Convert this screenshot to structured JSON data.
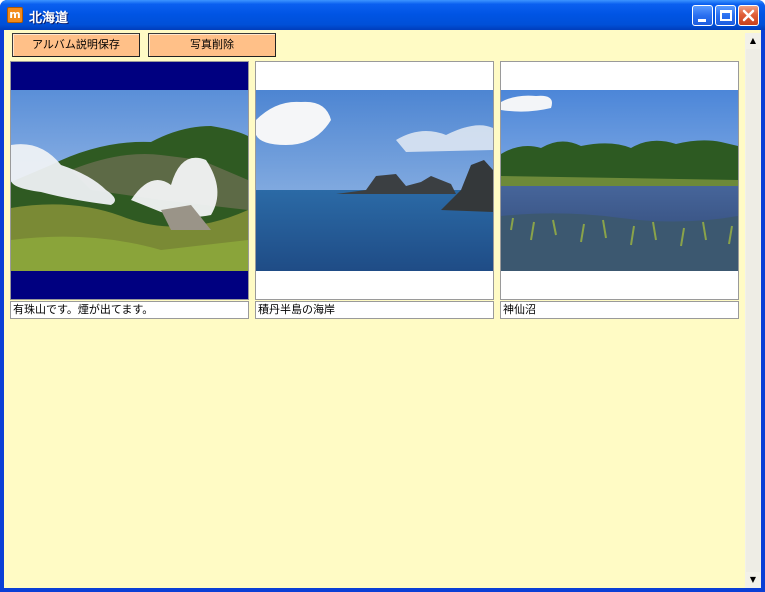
{
  "window": {
    "title": "北海道",
    "app_icon_glyph": "m"
  },
  "toolbar": {
    "save_label": "アルバム説明保存",
    "delete_label": "写真削除"
  },
  "photos": [
    {
      "caption": "有珠山です。煙が出てます。",
      "mat_color": "#000080",
      "scene": "volcano-steam-icon"
    },
    {
      "caption": "積丹半島の海岸",
      "mat_color": "#ffffff",
      "scene": "coast-rocks-icon"
    },
    {
      "caption": "神仙沼",
      "mat_color": "#ffffff",
      "scene": "marsh-pond-icon"
    }
  ],
  "scrollbar": {
    "up_glyph": "▲",
    "down_glyph": "▼"
  },
  "colors": {
    "client_bg": "#fffbc5",
    "button_bg": "#ffc088"
  }
}
